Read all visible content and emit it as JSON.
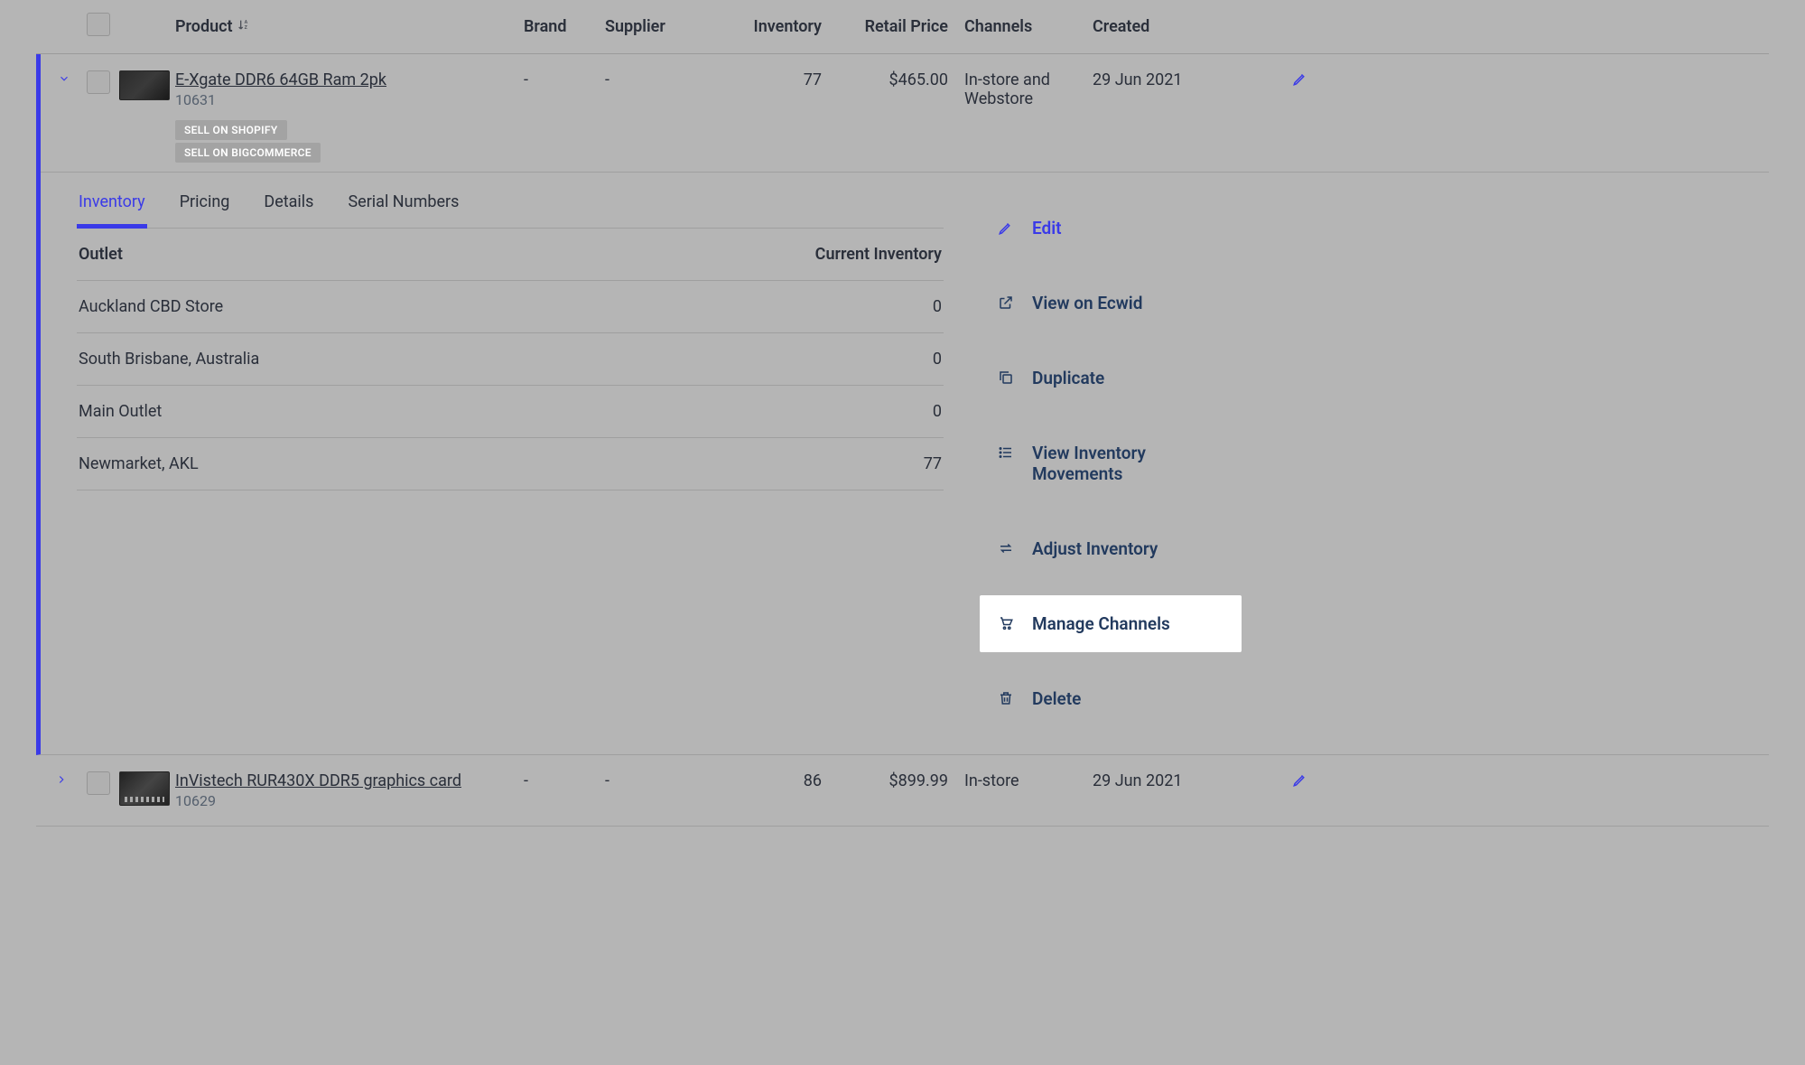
{
  "columns": {
    "product": "Product",
    "brand": "Brand",
    "supplier": "Supplier",
    "inventory": "Inventory",
    "retail_price": "Retail Price",
    "channels": "Channels",
    "created": "Created"
  },
  "sort_indicator": "↓A–Z",
  "rows": [
    {
      "expanded": true,
      "product_name": "E-Xgate DDR6 64GB Ram 2pk",
      "sku": "10631",
      "brand": "-",
      "supplier": "-",
      "inventory": "77",
      "retail_price": "$465.00",
      "channels": "In-store and Webstore",
      "created": "29 Jun 2021",
      "badges": [
        "SELL ON SHOPIFY",
        "SELL ON BIGCOMMERCE"
      ],
      "detail": {
        "tabs": [
          "Inventory",
          "Pricing",
          "Details",
          "Serial Numbers"
        ],
        "active_tab": "Inventory",
        "inventory_table": {
          "outlet_header": "Outlet",
          "current_header": "Current Inventory",
          "rows": [
            {
              "outlet": "Auckland CBD Store",
              "inventory": "0"
            },
            {
              "outlet": "South Brisbane, Australia",
              "inventory": "0"
            },
            {
              "outlet": "Main Outlet",
              "inventory": "0"
            },
            {
              "outlet": "Newmarket, AKL",
              "inventory": "77"
            }
          ]
        },
        "actions": {
          "edit": "Edit",
          "view_ecwid": "View on Ecwid",
          "duplicate": "Duplicate",
          "view_movements": "View Inventory Movements",
          "adjust_inventory": "Adjust Inventory",
          "manage_channels": "Manage Channels",
          "delete": "Delete"
        }
      }
    },
    {
      "expanded": false,
      "product_name": "InVistech RUR430X DDR5 graphics card",
      "sku": "10629",
      "brand": "-",
      "supplier": "-",
      "inventory": "86",
      "retail_price": "$899.99",
      "channels": "In-store",
      "created": "29 Jun 2021"
    }
  ]
}
